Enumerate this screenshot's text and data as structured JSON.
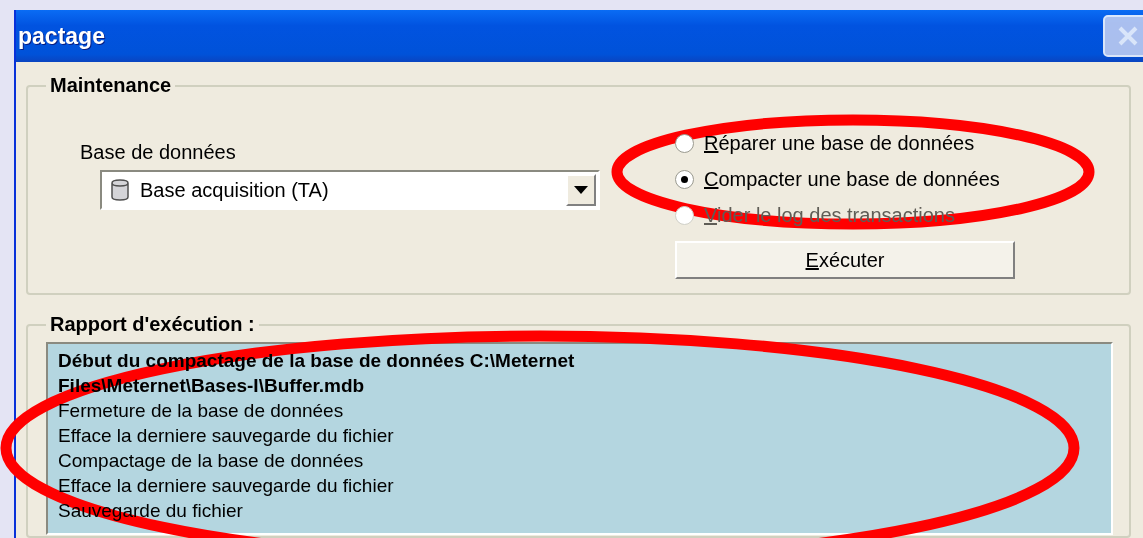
{
  "window": {
    "title": "pactage"
  },
  "maintenance": {
    "title": "Maintenance",
    "database_label": "Base de données",
    "database_value": "Base acquisition (TA)",
    "options": [
      {
        "label": "Réparer une base de données",
        "selected": false,
        "disabled": false
      },
      {
        "label": "Compacter une base de données",
        "selected": true,
        "disabled": false
      },
      {
        "label": "Vider le log des transactions",
        "selected": false,
        "disabled": true
      }
    ],
    "execute_button": "Exécuter"
  },
  "report": {
    "title": "Rapport d'exécution :",
    "lines": [
      {
        "text": "Début du compactage de la base de données C:\\Meternet Files\\Meternet\\Bases-I\\Buffer.mdb",
        "kind": "header"
      },
      {
        "text": "Fermeture de la base de données",
        "kind": "step"
      },
      {
        "text": "Efface la derniere sauvegarde du fichier",
        "kind": "step"
      },
      {
        "text": "Compactage de la base de données",
        "kind": "step"
      },
      {
        "text": "Efface la derniere sauvegarde du fichier",
        "kind": "step"
      },
      {
        "text": "Sauvegarde du fichier",
        "kind": "step"
      }
    ]
  }
}
